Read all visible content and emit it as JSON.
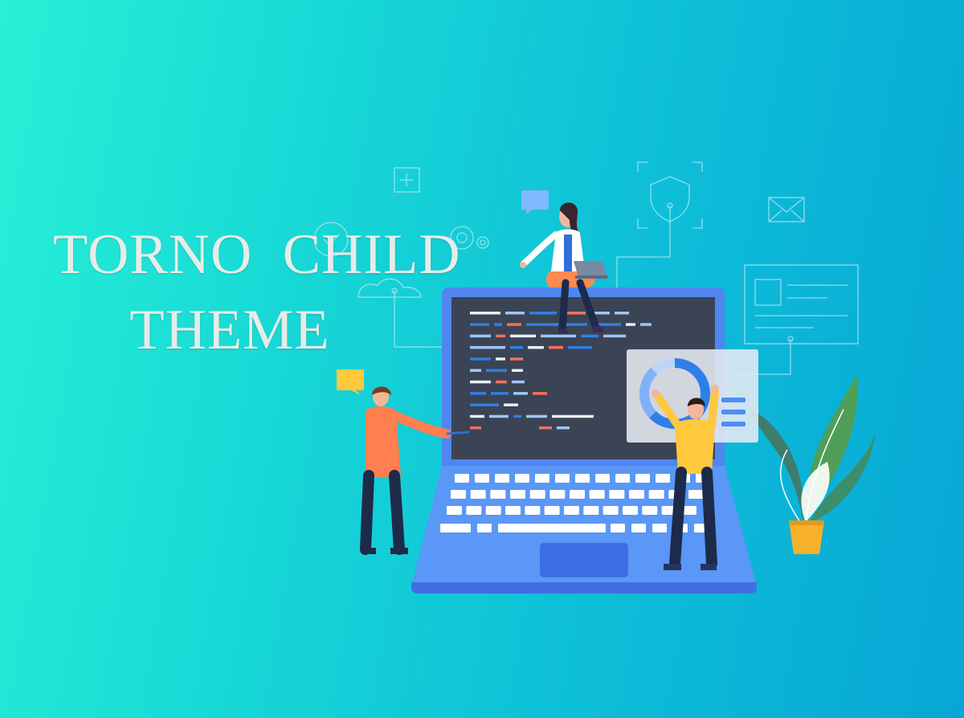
{
  "hero": {
    "title_line1": "TORNO  CHILD",
    "title_line2": "THEME"
  },
  "colors": {
    "bg_start": "#27f0d6",
    "bg_end": "#07a6d6",
    "title": "#e6ece8",
    "screen": "#3a4454",
    "laptop_body": "#4f8cf6",
    "keyboard_key": "#ffffff",
    "man_left_shirt": "#ff7f50",
    "man_right_shirt": "#ffc83d",
    "woman_skirt": "#ff8a50",
    "pants": "#1e2a4a",
    "plant_leaf": "#3f8f4f",
    "pot": "#f8b12c",
    "code_blue": "#2f7fe8",
    "code_light": "#9ec6ff",
    "code_white": "#e8eef8",
    "code_orange": "#f5725a"
  },
  "icons": [
    "plus-icon",
    "shield-icon",
    "mail-icon",
    "gear-icon",
    "check-circle-icon",
    "cloud-icon",
    "chat-bubble-icon",
    "donut-chart-icon",
    "laptop-icon",
    "plant-icon"
  ]
}
